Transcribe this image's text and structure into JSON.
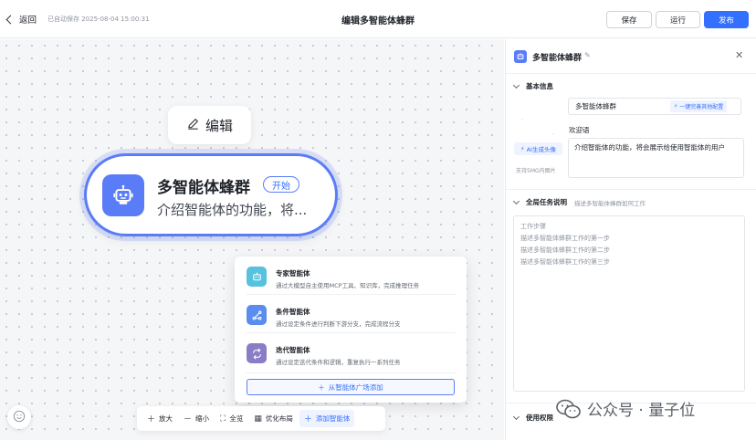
{
  "header": {
    "back_label": "返回",
    "autosave": "已自动保存 2025-08-04 15:00:31",
    "title": "编辑多智能体蜂群",
    "save_label": "保存",
    "run_label": "运行",
    "publish_label": "发布"
  },
  "canvas": {
    "edit_label": "编辑",
    "node": {
      "title": "多智能体蜂群",
      "tag": "开始",
      "description": "介绍智能体的功能，将..."
    },
    "add_menu": {
      "items": [
        {
          "title": "专家智能体",
          "desc": "通过大模型自主使用MCP工具、知识库，完成推理任务",
          "icon": "robot-icon",
          "color": "#56c2dd"
        },
        {
          "title": "条件智能体",
          "desc": "通过设定条件进行判断下游分支，完成流程分支",
          "icon": "branch-icon",
          "color": "#5b8def"
        },
        {
          "title": "迭代智能体",
          "desc": "通过设定迭代条件和逻辑，重复执行一系列任务",
          "icon": "loop-icon",
          "color": "#8a7cc6"
        }
      ],
      "plaza_label": "从智能体广场添加"
    },
    "toolbar": {
      "zoom_in": "放大",
      "zoom_out": "缩小",
      "fit": "全览",
      "optimize": "优化布局",
      "add_agent": "添加智能体"
    }
  },
  "panel": {
    "title": "多智能体蜂群",
    "basic_section": "基本信息",
    "name_value": "多智能体蜂群",
    "optimize_label": "一键完善其他配置",
    "ai_avatar_label": "AI生成头像",
    "format_hint": "支持5MG内图片",
    "greeting_label": "欢迎语",
    "greeting_value": "介绍智能体的功能，将会展示给使用智能体的用户",
    "task_section": "全局任务说明",
    "task_hint": "描述多智能体蜂群如何工作",
    "task_lines": [
      "工作步骤",
      "描述多智能体蜂群工作的第一步",
      "描述多智能体蜂群工作的第二步",
      "描述多智能体蜂群工作的第三步"
    ],
    "permission_section": "使用权限"
  },
  "watermark": {
    "text": "公众号 · 量子位"
  },
  "colors": {
    "accent": "#3370ff",
    "node_border": "#5b7cf7"
  }
}
